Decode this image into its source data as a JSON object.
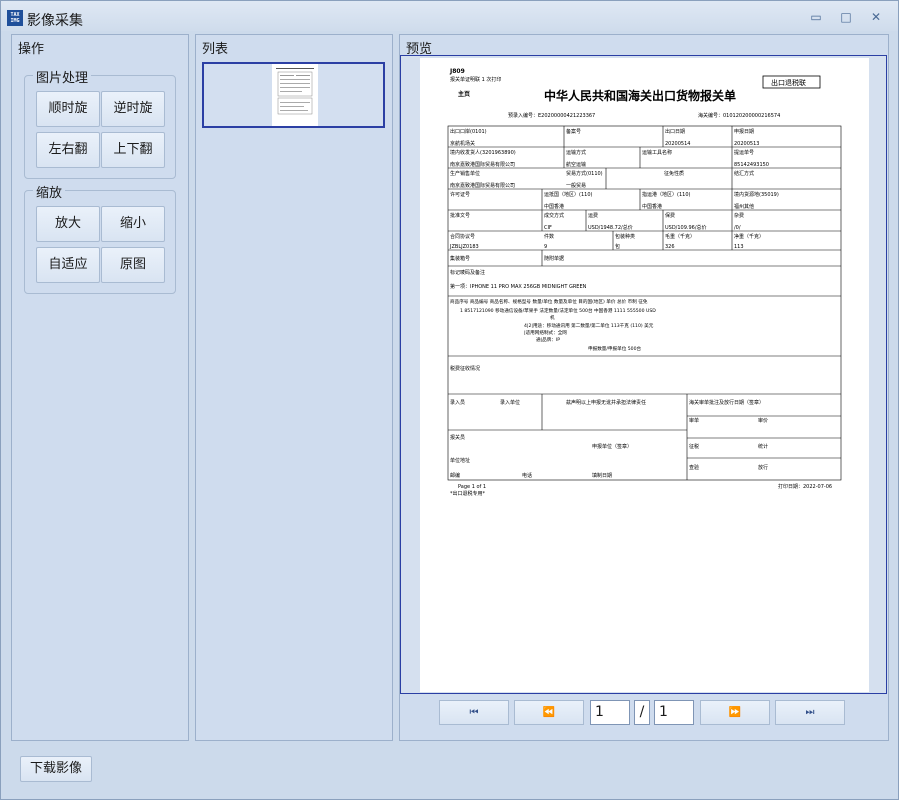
{
  "window": {
    "title": "影像采集",
    "icon_text": "TAX IMG",
    "controls": {
      "minimize": "▭",
      "maximize": "□",
      "close": "✕"
    }
  },
  "panels": {
    "operations": {
      "title": "操作",
      "image_group": {
        "title": "图片处理",
        "buttons": [
          "顺时旋",
          "逆时旋",
          "左右翻",
          "上下翻"
        ]
      },
      "zoom_group": {
        "title": "缩放",
        "buttons": [
          "放大",
          "缩小",
          "自适应",
          "原图"
        ]
      }
    },
    "list": {
      "title": "列表"
    },
    "preview": {
      "title": "预览"
    }
  },
  "pager": {
    "first": "⏮",
    "prev": "⏪",
    "next": "⏩",
    "last": "⏭",
    "current_page": "1",
    "separator": "/",
    "total_pages": "1"
  },
  "download_label": "下载影像",
  "document": {
    "code": "J809",
    "print_note": "报关单证明联 1 次打印",
    "main_page": "主页",
    "title": "中华人民共和国海关出口货物报关单",
    "stamp": "出口退税联",
    "pre_entry": "预录入编号：E20200000421223367",
    "customs_no": "海关编号：010120200000216574",
    "fields": {
      "export_port_label": "出口口岸(0101)",
      "export_port_value": "京航机场关",
      "record_no_label": "备案号",
      "export_date_label": "出口日期",
      "export_date_value": "20200514",
      "declare_date_label": "申报日期",
      "declare_date_value": "20200513",
      "consignee_label": "境内收发货人(3201963890)",
      "consignee_value": "南京嘉致港国际贸易有限公司",
      "transport_label": "运输方式",
      "transport_value": "航空运输",
      "vehicle_label": "运输工具名称",
      "bill_label": "提运单号",
      "bill_value": "85142493150",
      "producer_label": "生产销售单位",
      "producer_value": "南京嘉致港国际贸易有限公司",
      "trade_label": "贸易方式(0110)",
      "trade_value": "一般贸易",
      "tax_nature_label": "征免性质",
      "settle_label": "结汇方式",
      "license_label": "许可证号",
      "origin_label": "运抵国（地区）(110)",
      "origin_value": "中国香港",
      "dest_port_label": "指运港（地区）(110)",
      "dest_port_value": "中国香港",
      "source_label": "境内货源地(35019)",
      "source_value": "福州其他",
      "approval_label": "批准文号",
      "deal_label": "成交方式",
      "deal_value": "CIF",
      "freight_label": "运费",
      "freight_value": "USD/1948.72/总价",
      "insurance_label": "保费",
      "insurance_value": "USD/109.96/总价",
      "misc_label": "杂费",
      "misc_value": "/0/",
      "contract_label": "合同协议号",
      "contract_value": "JZBLJZ0183",
      "pieces_label": "件数",
      "pieces_value": "9",
      "package_label": "包装种类",
      "package_value": "包",
      "gross_label": "毛重（千克）",
      "gross_value": "326",
      "net_label": "净重（千克）",
      "net_value": "113",
      "container_label": "集装箱号",
      "docs_label": "随附单据",
      "marks_label": "标记唛码及备注",
      "marks_value": "第一项：IPHONE 11 PRO MAX  256GB MIDNIGHT GREEN",
      "goods_header": "商品序号  商品编号  商品名称、规格型号    数量/单位   数量及单位   目的国(地区)   单价    总价    币制   征免",
      "goods_line1": "1       8517121090   移动通信设备/苹果手   法定数量/法定单位     500台       中国香港      1111    555500    USD",
      "goods_line2": "机",
      "goods_line3": "4|2|用途：移动通讯用  第二数量/第二单位    113千克       (110)                     美元",
      "goods_line4": "|适用网络制式：全网",
      "goods_line5": "通|品牌：IP",
      "goods_line6": "申报数量/申报单位      500台",
      "tax_label": "税费征收情况",
      "entry_person": "录入员",
      "entry_unit": "录入单位",
      "declaration": "兹声明以上申报无讹并承担法律责任",
      "approve_label": "海关审单批注及放行日期（签章）",
      "review_label": "审单",
      "price_label": "审价",
      "declarant_label": "报关员",
      "declare_unit_label": "申报单位（签章）",
      "levy_label": "征税",
      "stats_label": "统计",
      "unit_addr_label": "单位地址",
      "inspect_label": "查验",
      "release_label": "放行",
      "postcode_label": "邮编",
      "phone_label": "电话",
      "fill_date_label": "填制日期",
      "page_info": "Page 1 of 1",
      "footer_note": "*出口退税专用*",
      "print_date": "打印日期：2022-07-06"
    }
  }
}
